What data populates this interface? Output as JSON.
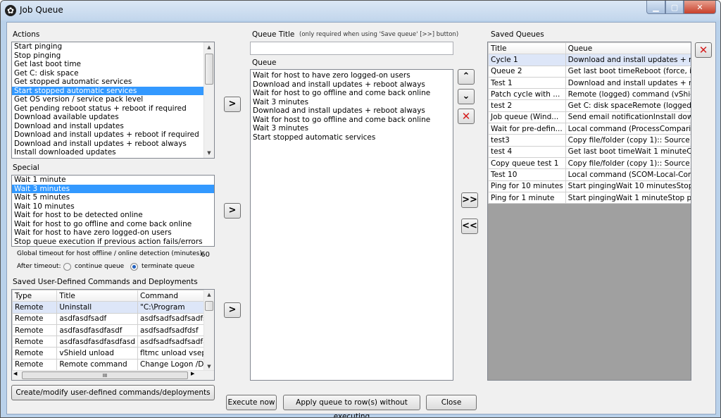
{
  "window": {
    "title": "Job Queue"
  },
  "actions": {
    "label": "Actions",
    "items": [
      "Start pinging",
      "Stop pinging",
      "Get last boot time",
      "Get C: disk space",
      "Get stopped automatic services",
      "Start stopped automatic services",
      "Get OS version / service pack level",
      "Get pending reboot status + reboot if required",
      "Download available updates",
      "Download and install updates",
      "Download and install updates + reboot if required",
      "Download and install updates + reboot always",
      "Install downloaded updates"
    ],
    "selected_index": 5
  },
  "special": {
    "label": "Special",
    "items": [
      "Wait 1 minute",
      "Wait 3 minutes",
      "Wait 5 minutes",
      "Wait 10 minutes",
      "Wait for host to be detected online",
      "Wait for host to go offline and come back online",
      "Wait for host to have zero logged-on users",
      "Stop queue execution if previous action fails/errors"
    ],
    "selected_index": 1,
    "timeout_label": "Global timeout for host offline / online detection (minutes):",
    "timeout_value": "60",
    "after_timeout_label": "After timeout:",
    "continue_label": "continue queue",
    "terminate_label": "terminate queue"
  },
  "saved_commands": {
    "label": "Saved User-Defined Commands and Deployments",
    "columns": [
      "Type",
      "Title",
      "Command"
    ],
    "rows": [
      [
        "Remote",
        "Uninstall",
        "\"C:\\Program"
      ],
      [
        "Remote",
        "asdfasdfsadf",
        "asdfsadfsadfsadfsa"
      ],
      [
        "Remote",
        "asdfasdfasdfasdf",
        "asdfsadfsadfdsf"
      ],
      [
        "Remote",
        "asdfasdfasdfasdfasd",
        "asdfsadfsadfsadfas"
      ],
      [
        "Remote",
        "vShield unload",
        "fltmc unload vsepfl"
      ],
      [
        "Remote",
        "Remote command",
        "Change Logon /Di"
      ]
    ],
    "hscroll_thumb": "III",
    "modify_button": "Create/modify user-defined commands/deployments"
  },
  "queue_title": {
    "label": "Queue Title",
    "hint": "(only required when using 'Save queue' [>>] button)",
    "value": ""
  },
  "queue": {
    "label": "Queue",
    "items": [
      "Wait for host to have zero logged-on users",
      "Download and install updates + reboot always",
      "Wait for host to go offline and come back online",
      "Wait 3 minutes",
      "Download and install updates + reboot always",
      "Wait for host to go offline and come back online",
      "Wait 3 minutes",
      "Start stopped automatic services"
    ]
  },
  "saved_queues": {
    "label": "Saved Queues",
    "columns": [
      "Title",
      "Queue"
    ],
    "rows": [
      [
        "Cycle 1",
        "Download and install updates + reboo..."
      ],
      [
        "Queue 2",
        "Get last boot timeReboot (force, if req..."
      ],
      [
        "Test 1",
        "Download and install updates + reboo..."
      ],
      [
        "Patch cycle with ...",
        "Remote (logged) command (vShield u..."
      ],
      [
        "test 2",
        "Get C: disk spaceRemote (logged) co..."
      ],
      [
        "Job queue (Wind...",
        "Send email notificationInstall downloa..."
      ],
      [
        "Wait for pre-defin...",
        "Local command (ProcessComparison...."
      ],
      [
        "test3",
        "Copy file/folder (copy 1):: Source:: C:\\..."
      ],
      [
        "test 4",
        "Get last boot timeWait 1 minuteCopy fi..."
      ],
      [
        "Copy queue test 1",
        "Copy file/folder (copy 1):: Source:: C:\\..."
      ],
      [
        "Test 10",
        "Local command (SCOM-Local-Comma..."
      ],
      [
        "Ping for 10 minutes",
        "Start pingingWait 10 minutesStop ping..."
      ],
      [
        "Ping for 1 minute",
        "Start pingingWait 1 minuteStop pinging"
      ]
    ]
  },
  "buttons": {
    "execute": "Execute now",
    "apply": "Apply queue to row(s) without executing",
    "close": "Close",
    "add": ">",
    "up": "^",
    "down": "v",
    "remove": "✕",
    "save_queue": ">>",
    "load_queue": "<<"
  }
}
